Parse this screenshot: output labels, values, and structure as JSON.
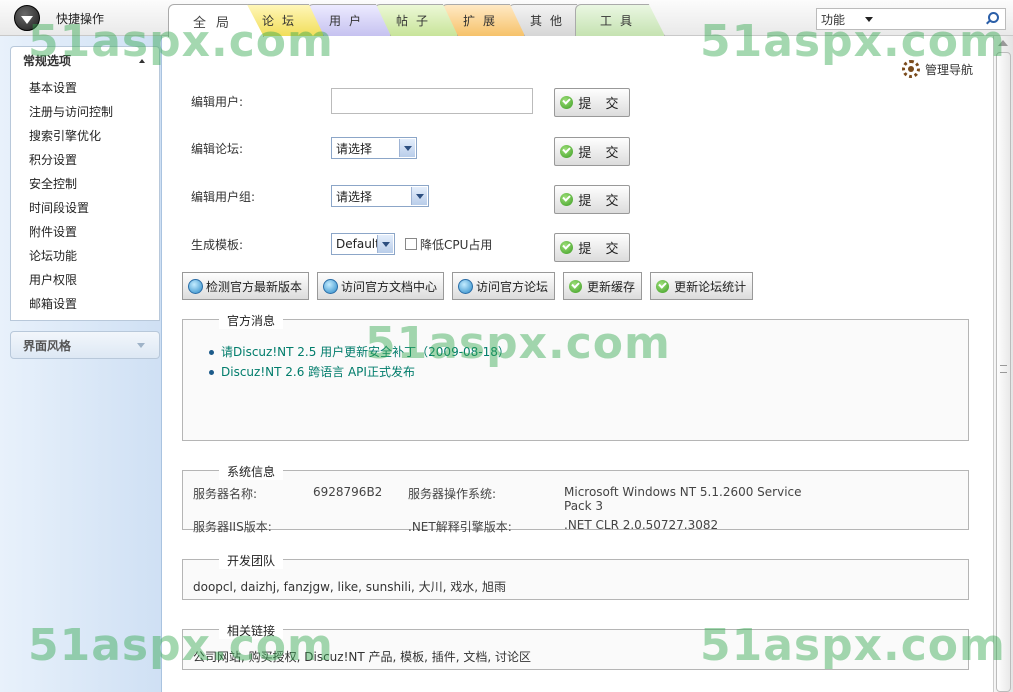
{
  "topbar": {
    "quick_label": "快捷操作"
  },
  "tabs": [
    "全局",
    "论坛",
    "用户",
    "帖子",
    "扩展",
    "其他",
    "工具"
  ],
  "search": {
    "scope": "功能",
    "value": ""
  },
  "sidebar": {
    "general_title": "常规选项",
    "items": [
      "基本设置",
      "注册与访问控制",
      "搜索引擎优化",
      "积分设置",
      "安全控制",
      "时间段设置",
      "附件设置",
      "论坛功能",
      "用户权限",
      "邮箱设置"
    ],
    "style_title": "界面风格"
  },
  "nav_guide": "管理导航",
  "form": {
    "edit_user_label": "编辑用户:",
    "edit_user_value": "",
    "edit_forum_label": "编辑论坛:",
    "edit_forum_value": "请选择",
    "edit_group_label": "编辑用户组:",
    "edit_group_value": "请选择",
    "template_label": "生成模板:",
    "template_value": "Default",
    "reduce_cpu_label": "降低CPU占用",
    "reduce_cpu_checked": false,
    "submit_label": "提 交"
  },
  "actions": [
    "检测官方最新版本",
    "访问官方文档中心",
    "访问官方论坛",
    "更新缓存",
    "更新论坛统计"
  ],
  "news": {
    "title": "官方消息",
    "items": [
      "请Discuz!NT 2.5 用户更新安全补丁（2009-08-18）",
      "Discuz!NT 2.6 跨语言  API正式发布"
    ]
  },
  "system": {
    "title": "系统信息",
    "server_name_label": "服务器名称:",
    "server_name": "6928796B2",
    "server_os_label": "服务器操作系统:",
    "server_os": "Microsoft Windows NT 5.1.2600 Service Pack 3",
    "iis_label": "服务器IIS版本:",
    "iis_value": "",
    "net_label": ".NET解释引擎版本:",
    "net_value": ".NET CLR 2.0.50727.3082"
  },
  "team": {
    "title": "开发团队",
    "members": "doopcl, daizhj, fanzjgw, like, sunshili, 大川, 戏水, 旭雨"
  },
  "links": {
    "title": "相关链接",
    "items": "公司网站, 购买授权, Discuz!NT 产品, 模板, 插件, 文档, 讨论区"
  },
  "watermark": "51aspx.com"
}
